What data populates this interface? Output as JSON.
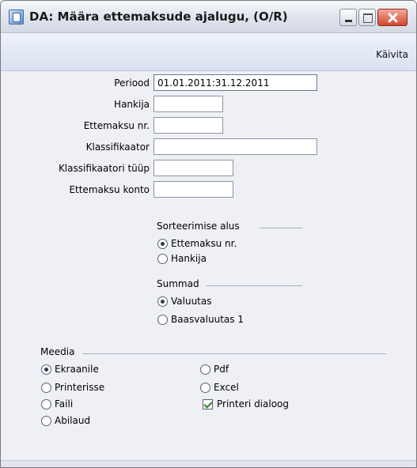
{
  "window": {
    "title": "DA: Määra ettemaksude ajalugu, (O/R)"
  },
  "toolbar": {
    "run_label": "Käivita"
  },
  "form": {
    "period_label": "Periood",
    "period_value": "01.01.2011:31.12.2011",
    "supplier_label": "Hankija",
    "supplier_value": "",
    "prepayment_no_label": "Ettemaksu nr.",
    "prepayment_no_value": "",
    "classification_label": "Klassifikaator",
    "classification_value": "",
    "classification_type_label": "Klassifikaatori tüüp",
    "classification_type_value": "",
    "prepayment_account_label": "Ettemaksu konto",
    "prepayment_account_value": ""
  },
  "sort": {
    "title": "Sorteerimise alus",
    "options": [
      "Ettemaksu nr.",
      "Hankija"
    ],
    "selected": 0
  },
  "sums": {
    "title": "Summad",
    "options": [
      "Valuutas",
      "Baasvaluutas 1"
    ],
    "selected": 0
  },
  "media": {
    "title": "Meedia",
    "left_options": [
      "Ekraanile",
      "Printerisse",
      "Faili",
      "Abilaud"
    ],
    "right_options": [
      "Pdf",
      "Excel"
    ],
    "selected": "Ekraanile",
    "printer_dialog_label": "Printeri dialoog",
    "printer_dialog_checked": true
  }
}
